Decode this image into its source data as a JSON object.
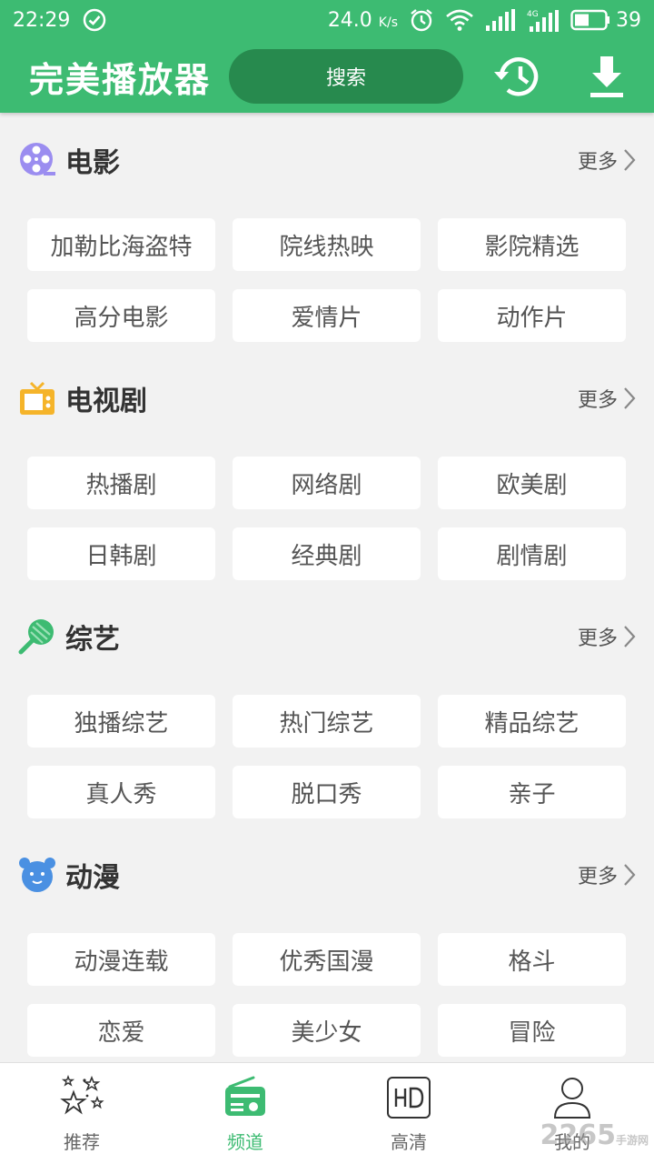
{
  "status_bar": {
    "time": "22:29",
    "net_speed": "24.0",
    "net_unit": "K/s",
    "battery": "39"
  },
  "app_bar": {
    "title": "完美播放器",
    "search_label": "搜索"
  },
  "sections": [
    {
      "title": "电影",
      "more": "更多",
      "icon": "film-reel-icon",
      "tags": [
        "加勒比海盗特",
        "院线热映",
        "影院精选",
        "高分电影",
        "爱情片",
        "动作片"
      ]
    },
    {
      "title": "电视剧",
      "more": "更多",
      "icon": "tv-icon",
      "tags": [
        "热播剧",
        "网络剧",
        "欧美剧",
        "日韩剧",
        "经典剧",
        "剧情剧"
      ]
    },
    {
      "title": "综艺",
      "more": "更多",
      "icon": "lollipop-icon",
      "tags": [
        "独播综艺",
        "热门综艺",
        "精品综艺",
        "真人秀",
        "脱口秀",
        "亲子"
      ]
    },
    {
      "title": "动漫",
      "more": "更多",
      "icon": "bear-face-icon",
      "tags": [
        "动漫连载",
        "优秀国漫",
        "格斗",
        "恋爱",
        "美少女",
        "冒险"
      ]
    }
  ],
  "bottom_nav": [
    {
      "label": "推荐",
      "icon": "stars-icon",
      "active": false
    },
    {
      "label": "频道",
      "icon": "radio-icon",
      "active": true
    },
    {
      "label": "高清",
      "icon": "hd-icon",
      "active": false
    },
    {
      "label": "我的",
      "icon": "person-icon",
      "active": false
    }
  ],
  "watermark": {
    "brand": "2265",
    "site": "手游网"
  },
  "colors": {
    "primary": "#3dbb72",
    "search_bg": "#278a4e",
    "film_icon": "#9b8df0",
    "tv_icon": "#f5b42a",
    "variety_icon": "#3dbb72",
    "anime_icon": "#4a90e2"
  }
}
